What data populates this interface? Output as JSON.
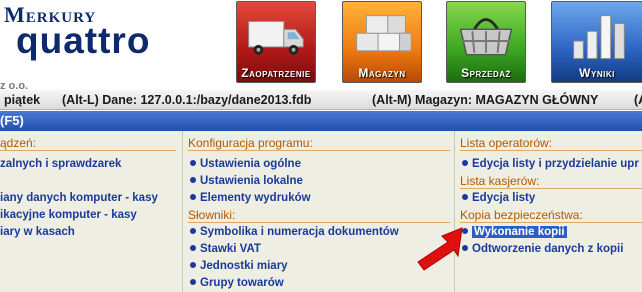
{
  "header": {
    "logo_top": "Merkury",
    "logo_main": "quattro",
    "company_suffix": "z o.o."
  },
  "tiles": [
    {
      "label": "Zaopatrzenie",
      "icon": "truck-icon"
    },
    {
      "label": "Magazyn",
      "icon": "boxes-icon"
    },
    {
      "label": "Sprzedaż",
      "icon": "basket-icon"
    },
    {
      "label": "Wyniki",
      "icon": "bar-chart-icon"
    }
  ],
  "status": {
    "day": "piątek",
    "db": "(Alt-L) Dane: 127.0.0.1:/bazy/dane2013.fdb",
    "warehouse": "(Alt-M) Magazyn: MAGAZYN GŁÓWNY",
    "overflow": "(A"
  },
  "title_bar": {
    "text": "(F5)"
  },
  "col1": {
    "section": "ądzeń:",
    "items": [
      "zalnych i sprawdzarek",
      "",
      "iany danych komputer - kasy",
      "ikacyjne komputer - kasy",
      "iary w kasach"
    ]
  },
  "col2": {
    "section1": "Konfiguracja programu:",
    "items1": [
      "Ustawienia ogólne",
      "Ustawienia lokalne",
      "Elementy wydruków"
    ],
    "section2": "Słowniki:",
    "items2": [
      "Symbolika i numeracja dokumentów",
      "Stawki VAT",
      "Jednostki miary",
      "Grupy towarów"
    ]
  },
  "col3": {
    "section1": "Lista operatorów:",
    "items1": [
      "Edycja listy i przydzielanie upr"
    ],
    "section2": "Lista kasjerów:",
    "items2": [
      "Edycja listy"
    ],
    "section3": "Kopia bezpieczeństwa:",
    "items3": [
      "Wykonanie kopii",
      "Odtworzenie danych z kopii"
    ]
  },
  "colors": {
    "brand": "#0d2a6e",
    "accent_blue": "#2350b0",
    "section_orange": "#b05a00",
    "link_blue": "#1a3a9a",
    "arrow_red": "#e01010"
  }
}
